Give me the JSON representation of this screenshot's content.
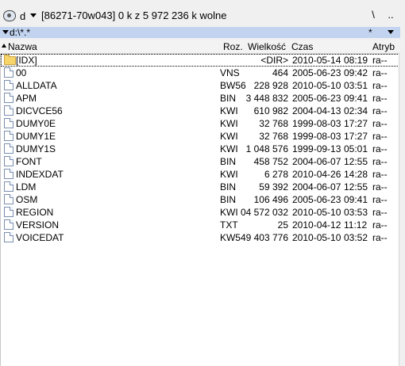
{
  "drive": {
    "letter": "d",
    "info": "[86271-70w043]  0 k z 5 972 236 k wolne",
    "root_label": "\\",
    "up_label": ".."
  },
  "path": {
    "text": "d:\\*.*",
    "filter": "*"
  },
  "columns": {
    "name": "Nazwa",
    "ext": "Roz.",
    "size": "Wielkość",
    "date": "Czas",
    "attr": "Atryb"
  },
  "files": [
    {
      "name": "[IDX]",
      "ext": "",
      "size": "<DIR>",
      "date": "2010-05-14",
      "time": "08:19",
      "attr": "ra--",
      "icon": "folder-icon"
    },
    {
      "name": "00",
      "ext": "VNS",
      "size": "464",
      "date": "2005-06-23",
      "time": "09:42",
      "attr": "ra--",
      "icon": "file-icon"
    },
    {
      "name": "ALLDATA",
      "ext": "BW56",
      "size": "228 928",
      "date": "2010-05-10",
      "time": "03:51",
      "attr": "ra--",
      "icon": "file-icon"
    },
    {
      "name": "APM",
      "ext": "BIN",
      "size": "3 448 832",
      "date": "2005-06-23",
      "time": "09:41",
      "attr": "ra--",
      "icon": "file-icon"
    },
    {
      "name": "DICVCE56",
      "ext": "KWI",
      "size": "610 982",
      "date": "2004-04-13",
      "time": "02:34",
      "attr": "ra--",
      "icon": "file-icon"
    },
    {
      "name": "DUMY0E",
      "ext": "KWI",
      "size": "32 768",
      "date": "1999-08-03",
      "time": "17:27",
      "attr": "ra--",
      "icon": "file-icon"
    },
    {
      "name": "DUMY1E",
      "ext": "KWI",
      "size": "32 768",
      "date": "1999-08-03",
      "time": "17:27",
      "attr": "ra--",
      "icon": "file-icon"
    },
    {
      "name": "DUMY1S",
      "ext": "KWI",
      "size": "1 048 576",
      "date": "1999-09-13",
      "time": "05:01",
      "attr": "ra--",
      "icon": "file-icon"
    },
    {
      "name": "FONT",
      "ext": "BIN",
      "size": "458 752",
      "date": "2004-06-07",
      "time": "12:55",
      "attr": "ra--",
      "icon": "file-icon"
    },
    {
      "name": "INDEXDAT",
      "ext": "KWI",
      "size": "6 278",
      "date": "2010-04-26",
      "time": "14:28",
      "attr": "ra--",
      "icon": "file-icon"
    },
    {
      "name": "LDM",
      "ext": "BIN",
      "size": "59 392",
      "date": "2004-06-07",
      "time": "12:55",
      "attr": "ra--",
      "icon": "file-icon"
    },
    {
      "name": "OSM",
      "ext": "BIN",
      "size": "106 496",
      "date": "2005-06-23",
      "time": "09:41",
      "attr": "ra--",
      "icon": "file-icon"
    },
    {
      "name": "REGION",
      "ext": "KWI",
      "size": "04 572 032",
      "date": "2010-05-10",
      "time": "03:53",
      "attr": "ra--",
      "icon": "file-icon"
    },
    {
      "name": "VERSION",
      "ext": "TXT",
      "size": "25",
      "date": "2010-04-12",
      "time": "11:12",
      "attr": "ra--",
      "icon": "file-icon"
    },
    {
      "name": "VOICEDAT",
      "ext": "KW",
      "size": "549 403 776",
      "date": "2010-05-10",
      "time": "03:52",
      "attr": "ra--",
      "icon": "file-icon"
    }
  ],
  "colors": {
    "path_bar": "#c1d3ef",
    "list_bg": "#ffffff",
    "window_bg": "#f0f0f0"
  }
}
